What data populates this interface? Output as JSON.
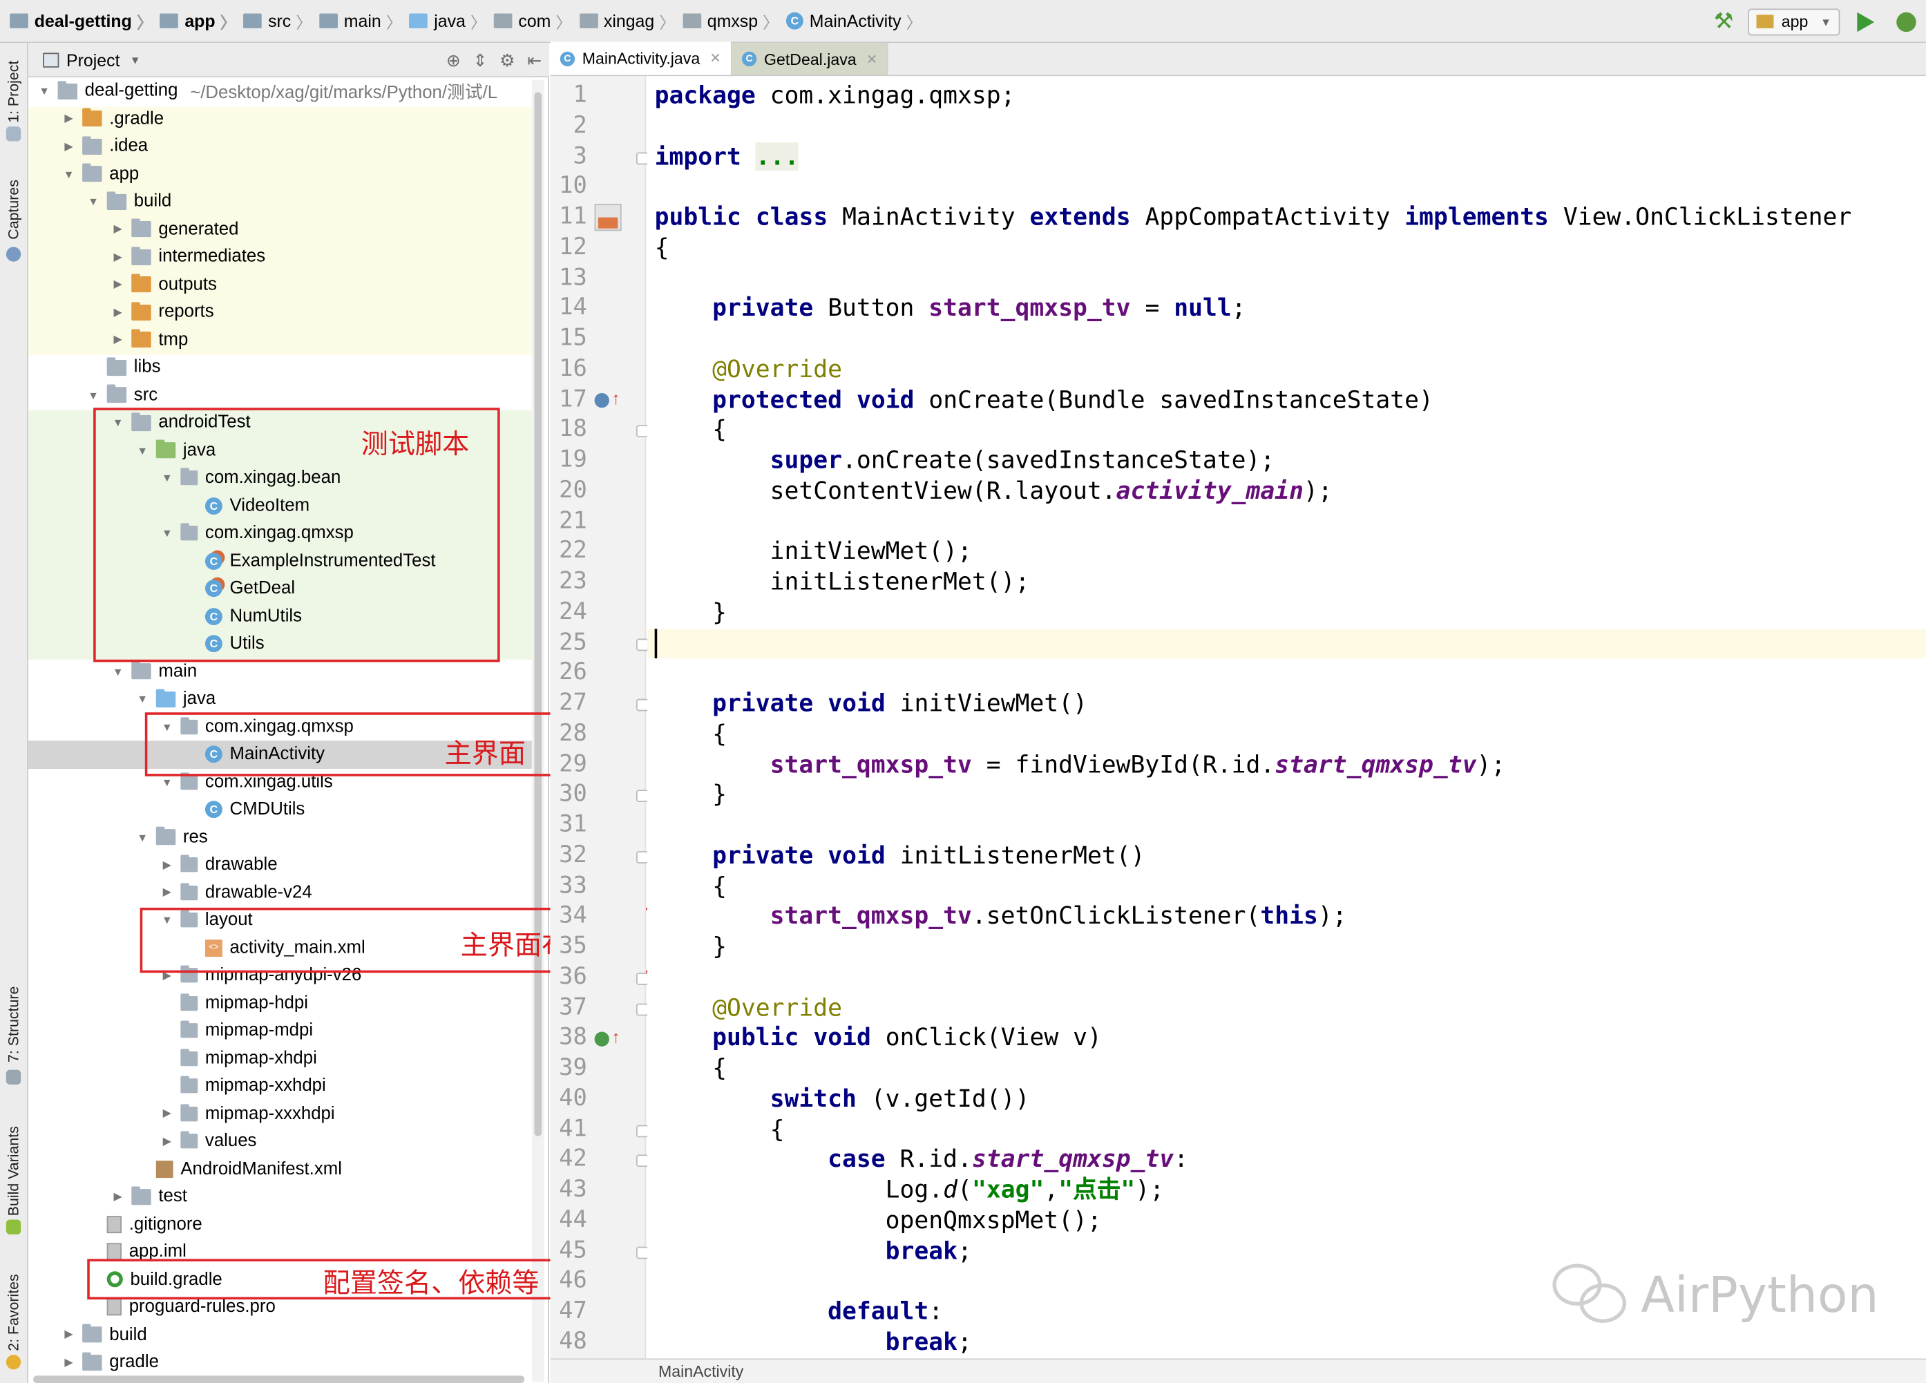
{
  "breadcrumbs": [
    "deal-getting",
    "app",
    "src",
    "main",
    "java",
    "com",
    "xingag",
    "qmxsp",
    "MainActivity"
  ],
  "run_config": "app",
  "side_tabs": {
    "project": "1: Project",
    "captures": "Captures",
    "structure": "7: Structure",
    "build_variants": "Build Variants",
    "favorites": "2: Favorites"
  },
  "project_panel": {
    "title": "Project"
  },
  "tree": [
    {
      "label": "deal-getting",
      "path": "~/Desktop/xag/git/marks/Python/测试/L"
    },
    {
      "label": ".gradle"
    },
    {
      "label": ".idea"
    },
    {
      "label": "app"
    },
    {
      "label": "build"
    },
    {
      "label": "generated"
    },
    {
      "label": "intermediates"
    },
    {
      "label": "outputs"
    },
    {
      "label": "reports"
    },
    {
      "label": "tmp"
    },
    {
      "label": "libs"
    },
    {
      "label": "src"
    },
    {
      "label": "androidTest"
    },
    {
      "label": "java"
    },
    {
      "label": "com.xingag.bean"
    },
    {
      "label": "VideoItem"
    },
    {
      "label": "com.xingag.qmxsp"
    },
    {
      "label": "ExampleInstrumentedTest"
    },
    {
      "label": "GetDeal"
    },
    {
      "label": "NumUtils"
    },
    {
      "label": "Utils"
    },
    {
      "label": "main"
    },
    {
      "label": "java"
    },
    {
      "label": "com.xingag.qmxsp"
    },
    {
      "label": "MainActivity"
    },
    {
      "label": "com.xingag.utils"
    },
    {
      "label": "CMDUtils"
    },
    {
      "label": "res"
    },
    {
      "label": "drawable"
    },
    {
      "label": "drawable-v24"
    },
    {
      "label": "layout"
    },
    {
      "label": "activity_main.xml"
    },
    {
      "label": "mipmap-anydpi-v26"
    },
    {
      "label": "mipmap-hdpi"
    },
    {
      "label": "mipmap-mdpi"
    },
    {
      "label": "mipmap-xhdpi"
    },
    {
      "label": "mipmap-xxhdpi"
    },
    {
      "label": "mipmap-xxxhdpi"
    },
    {
      "label": "values"
    },
    {
      "label": "AndroidManifest.xml"
    },
    {
      "label": "test"
    },
    {
      "label": ".gitignore"
    },
    {
      "label": "app.iml"
    },
    {
      "label": "build.gradle"
    },
    {
      "label": "proguard-rules.pro"
    },
    {
      "label": "build"
    },
    {
      "label": "gradle"
    }
  ],
  "annotations": {
    "test_scripts": "测试脚本",
    "main_ui": "主界面",
    "main_layout": "主界面布局",
    "config": "配置签名、依赖等"
  },
  "tabs": [
    {
      "label": "MainActivity.java"
    },
    {
      "label": "GetDeal.java"
    }
  ],
  "line_numbers": [
    "1",
    "2",
    "3",
    "10",
    "11",
    "12",
    "13",
    "14",
    "15",
    "16",
    "17",
    "18",
    "19",
    "20",
    "21",
    "22",
    "23",
    "24",
    "25",
    "26",
    "27",
    "28",
    "29",
    "30",
    "31",
    "32",
    "33",
    "34",
    "35",
    "36",
    "37",
    "38",
    "39",
    "40",
    "41",
    "42",
    "43",
    "44",
    "45",
    "46",
    "47",
    "48"
  ],
  "code": {
    "l1": [
      "package",
      " com.xingag.qmxsp;"
    ],
    "l3": [
      "import",
      " ",
      "..."
    ],
    "l11": [
      "public",
      " ",
      "class",
      " MainActivity ",
      "extends",
      " AppCompatActivity ",
      "implements",
      " View.OnClickListener"
    ],
    "l12": "{",
    "l14": [
      "    ",
      "private",
      " Button ",
      "start_qmxsp_tv",
      " = ",
      "null",
      ";"
    ],
    "l16": [
      "    ",
      "@Override"
    ],
    "l17": [
      "    ",
      "protected",
      " ",
      "void",
      " onCreate(Bundle savedInstanceState)"
    ],
    "l18": "    {",
    "l19": [
      "        ",
      "super",
      ".onCreate(savedInstanceState);"
    ],
    "l20": [
      "        setContentView(R.layout.",
      "activity_main",
      ");"
    ],
    "l22": "        initViewMet();",
    "l23": "        initListenerMet();",
    "l24": "    }",
    "l27": [
      "    ",
      "private",
      " ",
      "void",
      " initViewMet()"
    ],
    "l28": "    {",
    "l29": [
      "        ",
      "start_qmxsp_tv",
      " = findViewById(R.id.",
      "start_qmxsp_tv",
      ");"
    ],
    "l30": "    }",
    "l32": [
      "    ",
      "private",
      " ",
      "void",
      " initListenerMet()"
    ],
    "l33": "    {",
    "l34": [
      "        ",
      "start_qmxsp_tv",
      ".setOnClickListener(",
      "this",
      ");"
    ],
    "l35": "    }",
    "l37": [
      "    ",
      "@Override"
    ],
    "l38": [
      "    ",
      "public",
      " ",
      "void",
      " onClick(View v)"
    ],
    "l39": "    {",
    "l40": [
      "        ",
      "switch",
      " (v.getId())"
    ],
    "l41": "        {",
    "l42": [
      "            ",
      "case",
      " R.id.",
      "start_qmxsp_tv",
      ":"
    ],
    "l43": [
      "                Log.",
      "d",
      "(",
      "\"xag\"",
      ",",
      "\"点击\"",
      ");"
    ],
    "l44": "                openQmxspMet();",
    "l45": [
      "                ",
      "break",
      ";"
    ],
    "l47": [
      "            ",
      "default",
      ":"
    ],
    "l48": [
      "                ",
      "break",
      ";"
    ]
  },
  "status_bar": "MainActivity",
  "watermark": "AirPython"
}
